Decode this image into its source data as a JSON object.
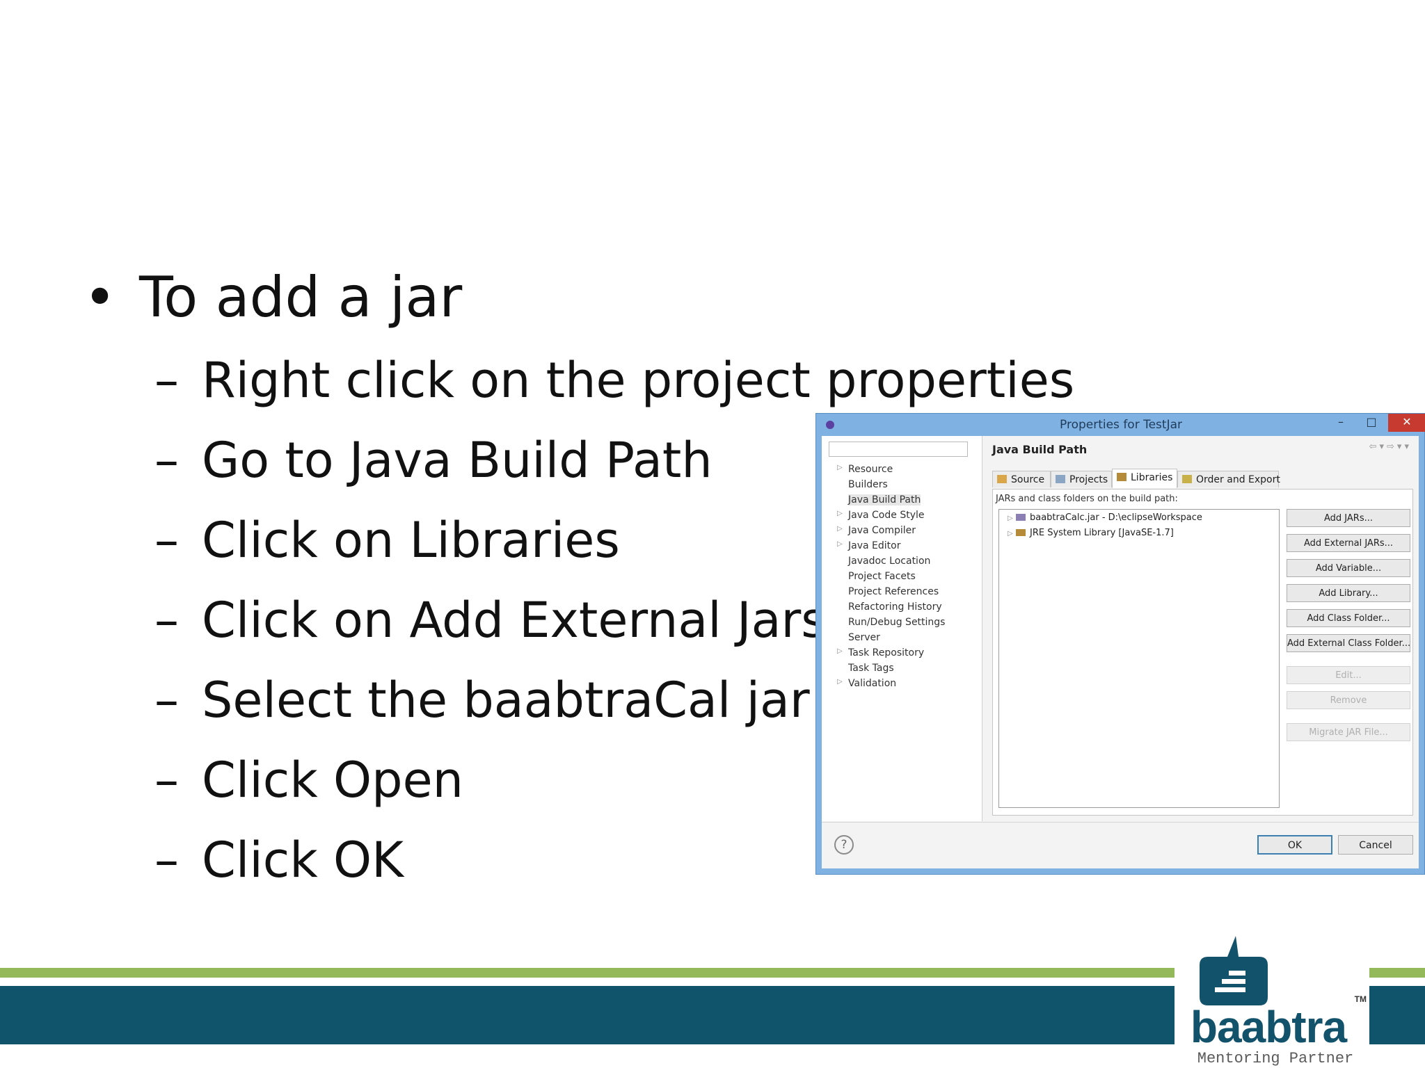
{
  "slide": {
    "bullet_main": "To add a jar",
    "steps": [
      "Right click on the project properties",
      "Go to Java Build Path",
      "Click on Libraries",
      "Click on Add External Jars",
      "Select the baabtraCal jar",
      "Click Open",
      "Click OK"
    ]
  },
  "dialog": {
    "title": "Properties for TestJar",
    "window_controls": {
      "minimize": "–",
      "maximize": "□",
      "close": "✕"
    },
    "tree": [
      "Resource",
      "Builders",
      "Java Build Path",
      "Java Code Style",
      "Java Compiler",
      "Java Editor",
      "Javadoc Location",
      "Project Facets",
      "Project References",
      "Refactoring History",
      "Run/Debug Settings",
      "Server",
      "Task Repository",
      "Task Tags",
      "Validation"
    ],
    "panel_title": "Java Build Path",
    "tabs": [
      "Source",
      "Projects",
      "Libraries",
      "Order and Export"
    ],
    "list_label": "JARs and class folders on the build path:",
    "entries": [
      "baabtraCalc.jar - D:\\eclipseWorkspace",
      "JRE System Library [JavaSE-1.7]"
    ],
    "buttons": [
      "Add JARs...",
      "Add External JARs...",
      "Add Variable...",
      "Add Library...",
      "Add Class Folder...",
      "Add External Class Folder...",
      "Edit...",
      "Remove",
      "Migrate JAR File..."
    ],
    "help_icon": "?",
    "ok": "OK",
    "cancel": "Cancel"
  },
  "logo": {
    "word": "baabtra",
    "tm": "TM",
    "tagline": "Mentoring Partner"
  },
  "colors": {
    "band_blue": "#10546b",
    "band_green": "#93b95a",
    "dialog_frame": "#7fb2e2"
  }
}
